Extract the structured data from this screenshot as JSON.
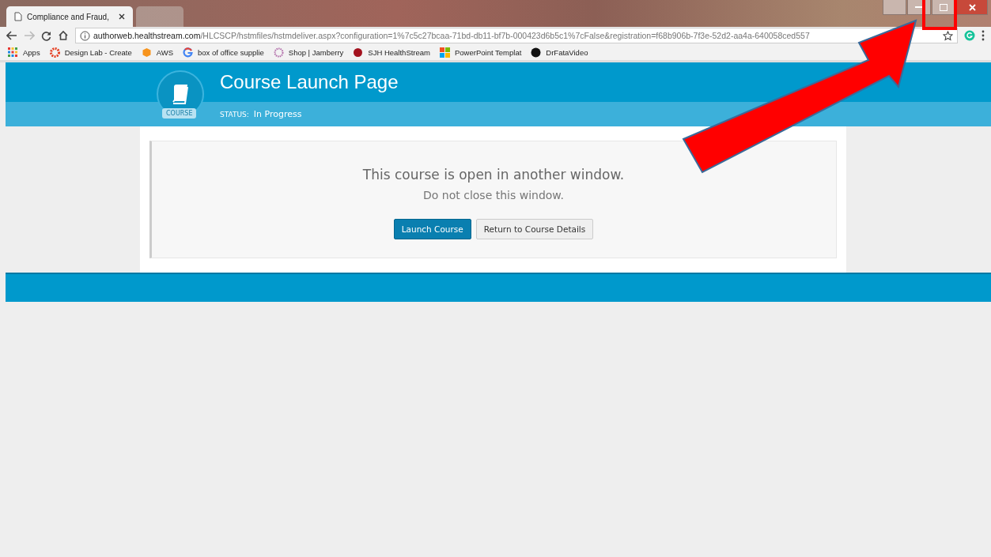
{
  "browser": {
    "tabs": [
      {
        "title": "Compliance and Fraud,",
        "selected": true
      },
      {
        "selected": false
      }
    ],
    "url_host": "authorweb.healthstream.com",
    "url_path": "/HLCSCP/hstmfiles/hstmdeliver.aspx?configuration=1%7c5c27bcaa-71bd-db11-bf7b-000423d6b5c1%7cFalse&registration=f68b906b-7f3e-52d2-aa4a-640058ced557",
    "bookmarks": [
      {
        "label": "Apps",
        "kind": "apps"
      },
      {
        "label": "Design Lab - Create",
        "kind": "gear"
      },
      {
        "label": "AWS",
        "kind": "cube"
      },
      {
        "label": "box of office supplie",
        "kind": "g"
      },
      {
        "label": "Shop | Jamberry",
        "kind": "flower"
      },
      {
        "label": "SJH HealthStream",
        "kind": "dot"
      },
      {
        "label": "PowerPoint Templat",
        "kind": "squares"
      },
      {
        "label": "DrFataVideo",
        "kind": "circle"
      }
    ]
  },
  "page": {
    "title": "Course Launch Page",
    "badge": "COURSE",
    "status_label": "STATUS:",
    "status_value": "In Progress",
    "message": "This course is open in another window.",
    "submessage": "Do not close this window.",
    "buttons": [
      {
        "label": "Launch Course",
        "kind": "primary"
      },
      {
        "label": "Return to Course Details",
        "kind": "secondary"
      }
    ]
  }
}
